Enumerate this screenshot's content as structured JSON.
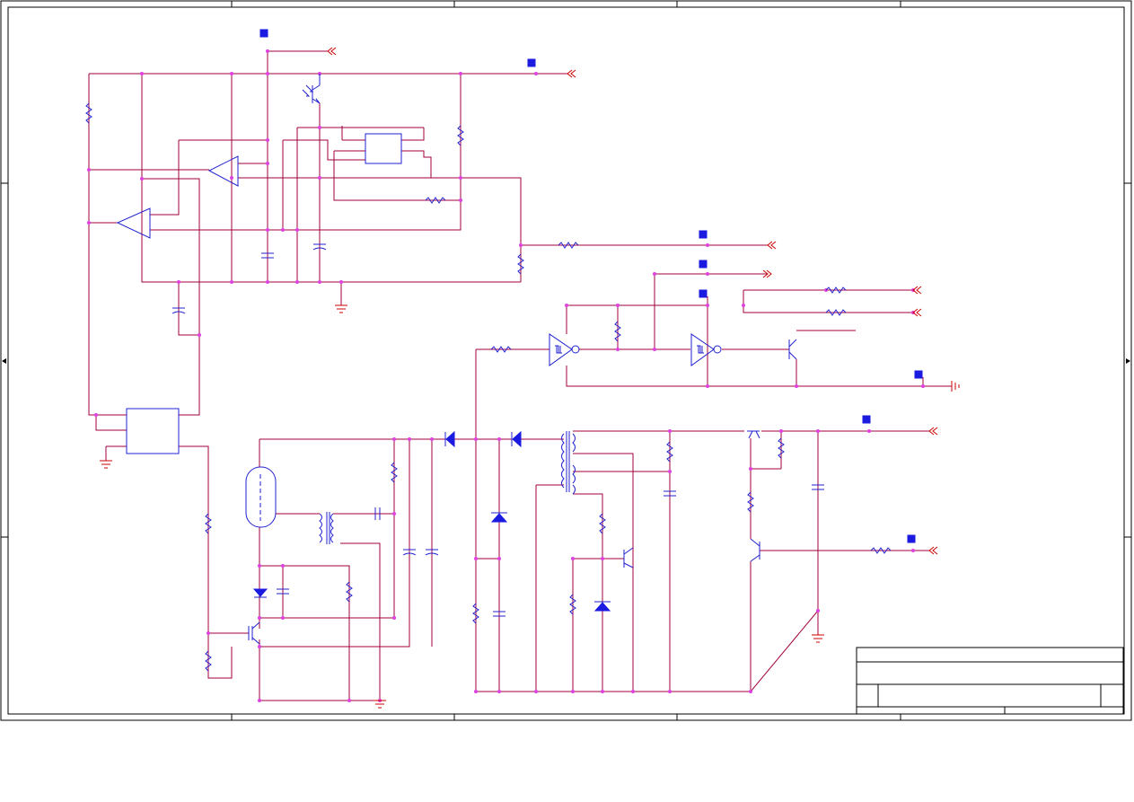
{
  "sheet": {
    "title": "",
    "title_block_fields": []
  },
  "colors": {
    "wire": "#a0003c",
    "component": "#2020d0",
    "junction": "#e040e0",
    "port": "#cc0000",
    "flag": "#1a1ae0",
    "frame": "#000000"
  }
}
